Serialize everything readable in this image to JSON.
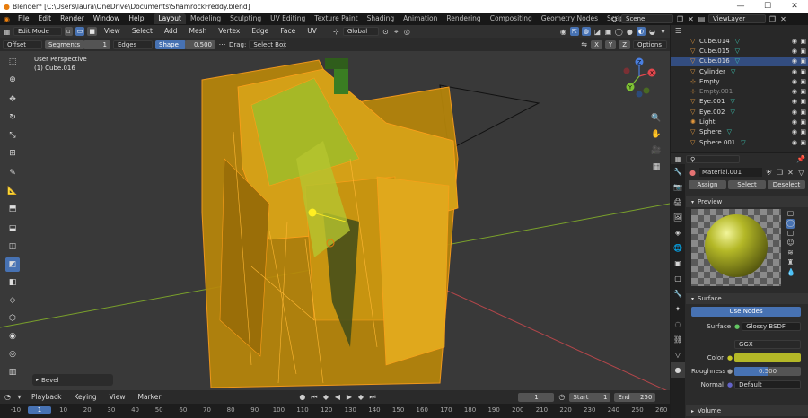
{
  "titlebar": {
    "title": "Blender* [C:\\Users\\laura\\OneDrive\\Documents\\ShamrockFreddy.blend]",
    "minimize": "—",
    "maximize": "☐",
    "close": "✕"
  },
  "menubar": {
    "menus": [
      "File",
      "Edit",
      "Render",
      "Window",
      "Help"
    ],
    "workspaces": [
      "Layout",
      "Modeling",
      "Sculpting",
      "UV Editing",
      "Texture Paint",
      "Shading",
      "Animation",
      "Rendering",
      "Compositing",
      "Geometry Nodes",
      "Scripting"
    ],
    "add_tab": "+",
    "scene": "Scene",
    "view_layer": "ViewLayer"
  },
  "viewport_header": {
    "mode": "Edit Mode",
    "menus": [
      "View",
      "Select",
      "Add",
      "Mesh",
      "Vertex",
      "Edge",
      "Face",
      "UV"
    ],
    "orientation": "Global",
    "options": "Options"
  },
  "tool_header": {
    "offset": "Offset",
    "segments_label": "Segments",
    "segments_value": "1",
    "affect": "Edges",
    "shape_label": "Shape",
    "shape_value": "0.500",
    "drag_label": "Drag:",
    "drag_value": "Select Box"
  },
  "viewport": {
    "perspective": "User Perspective",
    "object": "(1) Cube.016",
    "operator_panel": "Bevel",
    "axes": {
      "x": "X",
      "y": "Y",
      "z": "Z"
    }
  },
  "outliner": {
    "items": [
      {
        "name": "Cube.014",
        "type": "mesh",
        "selected": false,
        "dim": false
      },
      {
        "name": "Cube.015",
        "type": "mesh",
        "selected": false,
        "dim": false
      },
      {
        "name": "Cube.016",
        "type": "mesh",
        "selected": true,
        "dim": false
      },
      {
        "name": "Cylinder",
        "type": "mesh",
        "selected": false,
        "dim": false
      },
      {
        "name": "Empty",
        "type": "empty",
        "selected": false,
        "dim": false
      },
      {
        "name": "Empty.001",
        "type": "empty",
        "selected": false,
        "dim": true
      },
      {
        "name": "Eye.001",
        "type": "mesh",
        "selected": false,
        "dim": false
      },
      {
        "name": "Eye.002",
        "type": "mesh",
        "selected": false,
        "dim": false
      },
      {
        "name": "Light",
        "type": "light",
        "selected": false,
        "dim": false
      },
      {
        "name": "Sphere",
        "type": "mesh",
        "selected": false,
        "dim": false
      },
      {
        "name": "Sphere.001",
        "type": "mesh",
        "selected": false,
        "dim": false
      }
    ]
  },
  "properties": {
    "material_name": "Material.001",
    "slot_buttons": [
      "Assign",
      "Select",
      "Deselect"
    ],
    "preview_label": "Preview",
    "surface_label": "Surface",
    "use_nodes": "Use Nodes",
    "surface_field_label": "Surface",
    "surface_value": "Glossy BSDF",
    "distribution": "GGX",
    "color_label": "Color",
    "color_value": "#b4b827",
    "roughness_label": "Roughness",
    "roughness_value": "0.500",
    "normal_label": "Normal",
    "normal_value": "Default",
    "volume_label": "Volume"
  },
  "timeline": {
    "menus": [
      "Playback",
      "Keying",
      "View",
      "Marker"
    ],
    "current_frame": "1",
    "start_label": "Start",
    "start_value": "1",
    "end_label": "End",
    "end_value": "250",
    "ruler_ticks": [
      "-10",
      "1",
      "10",
      "20",
      "30",
      "40",
      "50",
      "60",
      "70",
      "80",
      "90",
      "100",
      "110",
      "120",
      "130",
      "140",
      "150",
      "160",
      "170",
      "180",
      "190",
      "200",
      "210",
      "220",
      "230",
      "240",
      "250",
      "260"
    ]
  },
  "colors": {
    "accent": "#4772b3",
    "selected_edge": "#ff9f1a",
    "material": "#b4b827"
  }
}
